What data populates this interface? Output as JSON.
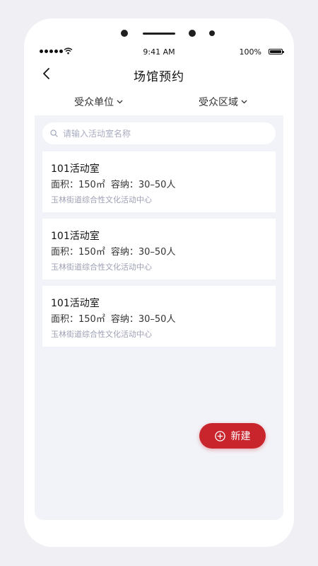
{
  "status_bar": {
    "time": "9:41 AM",
    "battery": "100%"
  },
  "nav": {
    "title": "场馆预约"
  },
  "filters": [
    {
      "label": "受众单位"
    },
    {
      "label": "受众区域"
    }
  ],
  "search": {
    "placeholder": "请输入活动室名称",
    "value": ""
  },
  "rooms": [
    {
      "name": "101活动室",
      "area_label": "面积：",
      "area": "150㎡",
      "capacity_label": "容纳：",
      "capacity": "30–50人",
      "org": "玉林街道综合性文化活动中心"
    },
    {
      "name": "101活动室",
      "area_label": "面积：",
      "area": "150㎡",
      "capacity_label": "容纳：",
      "capacity": "30–50人",
      "org": "玉林街道综合性文化活动中心"
    },
    {
      "name": "101活动室",
      "area_label": "面积：",
      "area": "150㎡",
      "capacity_label": "容纳：",
      "capacity": "30–50人",
      "org": "玉林街道综合性文化活动中心"
    }
  ],
  "fab": {
    "label": "新建"
  },
  "colors": {
    "accent": "#c9252c",
    "content_bg": "#f2f3f8",
    "muted_text": "#9ea0b4"
  }
}
